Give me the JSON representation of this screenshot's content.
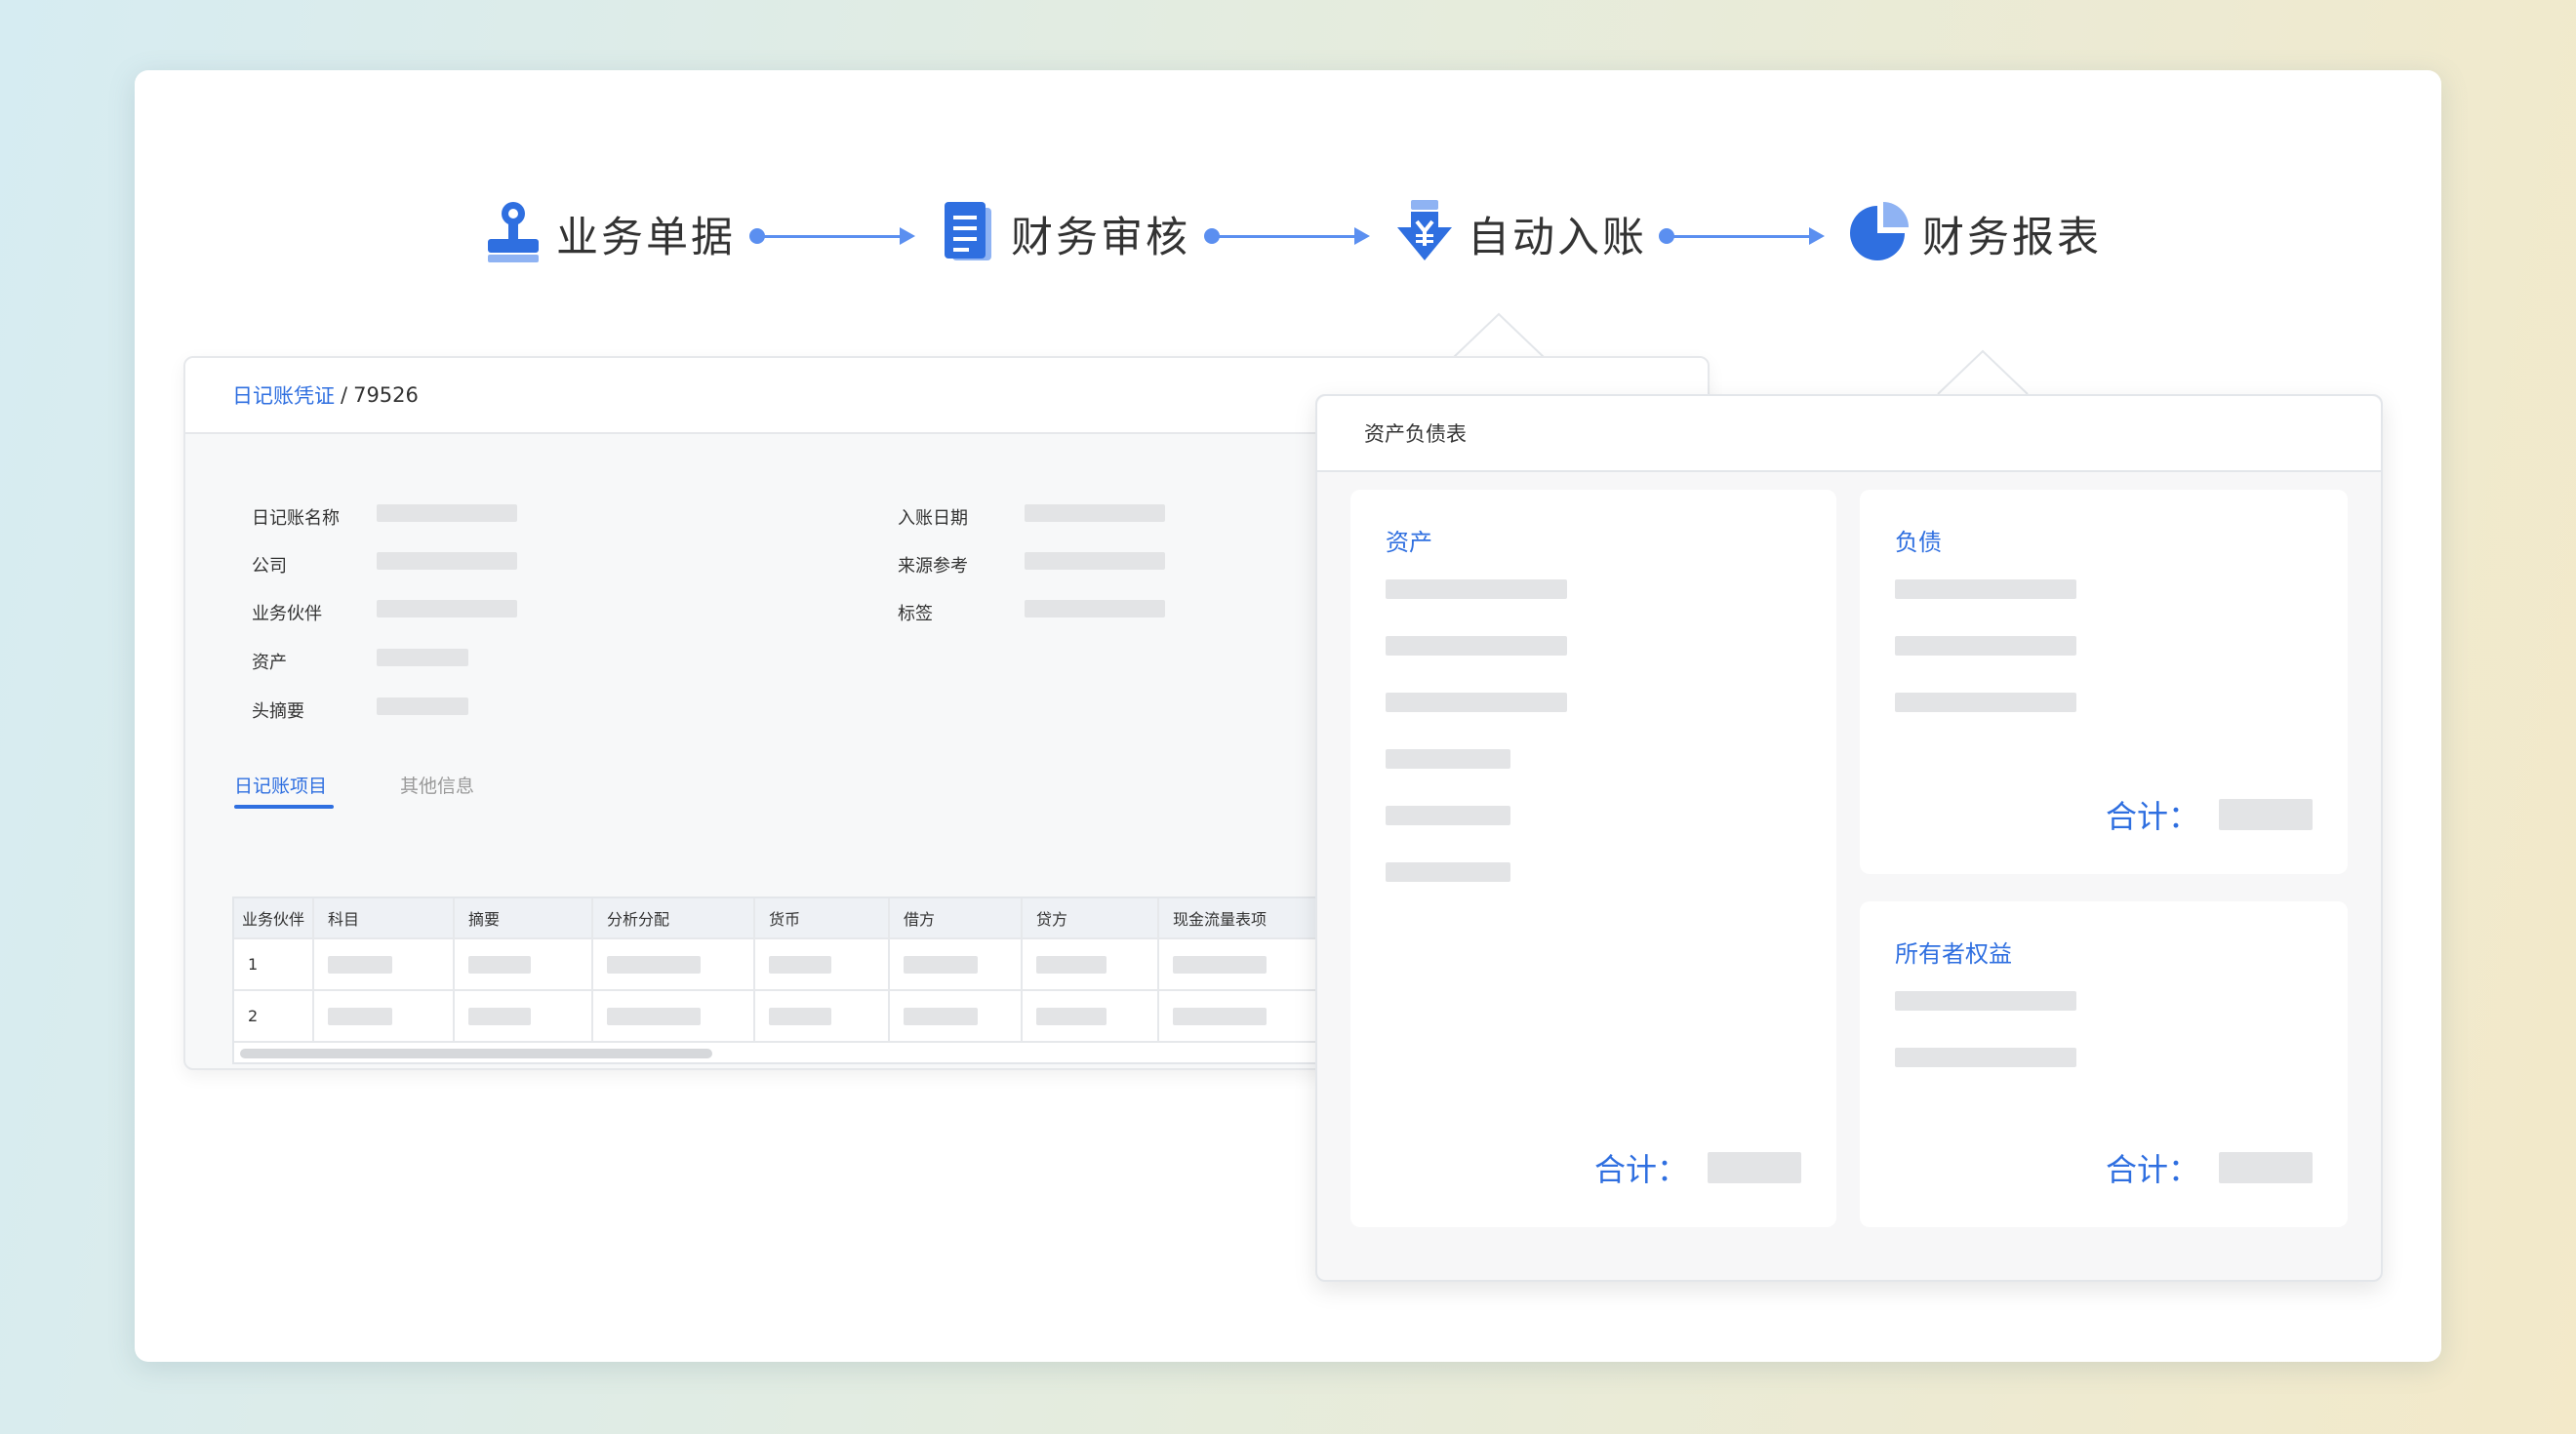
{
  "flow": {
    "steps": [
      {
        "label": "业务单据",
        "icon": "stamp-icon"
      },
      {
        "label": "财务审核",
        "icon": "document-icon"
      },
      {
        "label": "自动入账",
        "icon": "yen-download-icon"
      },
      {
        "label": "财务报表",
        "icon": "pie-chart-icon"
      }
    ],
    "accent": "#2f6fe0"
  },
  "voucher": {
    "breadcrumb_link": "日记账凭证",
    "breadcrumb_sep": "/",
    "breadcrumb_id": "79526",
    "left_fields": [
      "日记账名称",
      "公司",
      "业务伙伴",
      "资产",
      "头摘要"
    ],
    "right_fields": [
      "入账日期",
      "来源参考",
      "标签"
    ],
    "tabs": [
      "日记账项目",
      "其他信息"
    ],
    "columns": [
      "业务伙伴",
      "科目",
      "摘要",
      "分析分配",
      "货币",
      "借方",
      "贷方",
      "现金流量表项"
    ],
    "rows": [
      "1",
      "2"
    ]
  },
  "balance_sheet": {
    "title": "资产负债表",
    "assets": {
      "title": "资产",
      "total_label": "合计："
    },
    "liabilities": {
      "title": "负债",
      "total_label": "合计："
    },
    "equity": {
      "title": "所有者权益",
      "total_label": "合计："
    }
  }
}
